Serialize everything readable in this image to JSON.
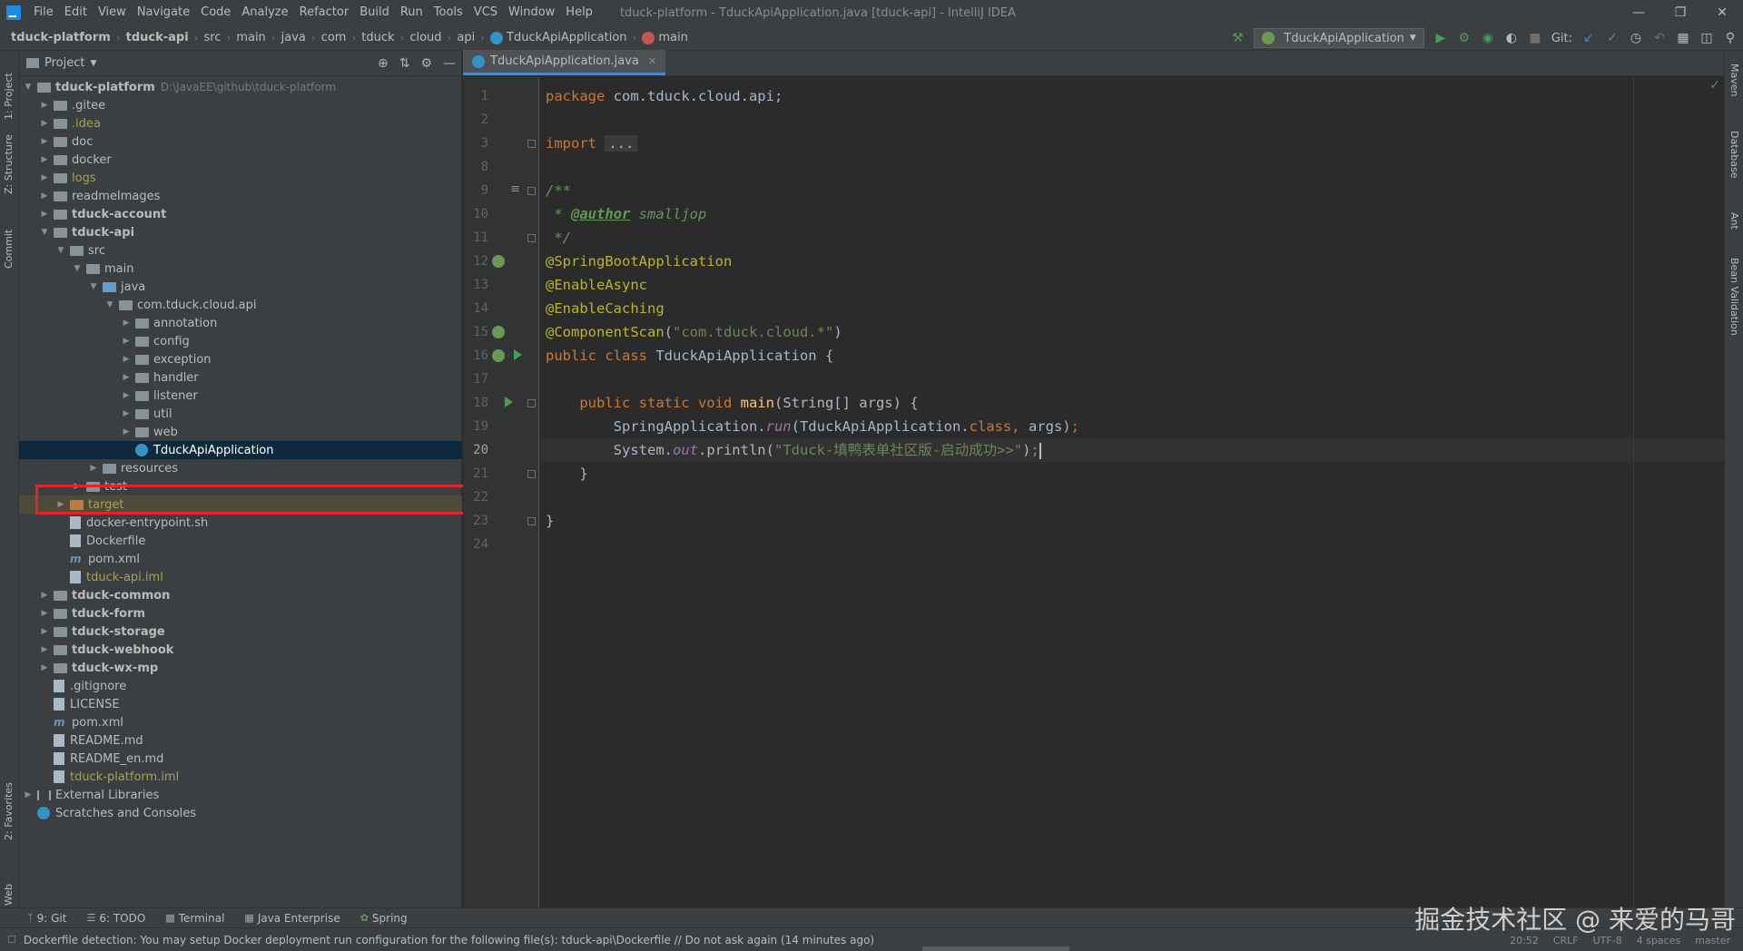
{
  "menubar": {
    "items": [
      "File",
      "Edit",
      "View",
      "Navigate",
      "Code",
      "Analyze",
      "Refactor",
      "Build",
      "Run",
      "Tools",
      "VCS",
      "Window",
      "Help"
    ],
    "title": "tduck-platform - TduckApiApplication.java [tduck-api] - IntelliJ IDEA"
  },
  "breadcrumb": [
    "tduck-platform",
    "tduck-api",
    "src",
    "main",
    "java",
    "com",
    "tduck",
    "cloud",
    "api",
    "TduckApiApplication",
    "main"
  ],
  "toolbar": {
    "run_config": "TduckApiApplication",
    "git_label": "Git:"
  },
  "left_stripe": {
    "project": "1: Project",
    "structure": "Z: Structure",
    "commit": "Commit",
    "favorites": "2: Favorites",
    "web": "Web"
  },
  "right_stripe": {
    "maven": "Maven",
    "database": "Database",
    "ant": "Ant",
    "bean": "Bean Validation"
  },
  "project_panel": {
    "title": "Project"
  },
  "tree": [
    {
      "label": "tduck-platform",
      "path": "D:\\JavaEE\\github\\tduck-platform"
    },
    {
      "label": ".gitee"
    },
    {
      "label": ".idea"
    },
    {
      "label": "doc"
    },
    {
      "label": "docker"
    },
    {
      "label": "logs"
    },
    {
      "label": "readmeImages"
    },
    {
      "label": "tduck-account"
    },
    {
      "label": "tduck-api"
    },
    {
      "label": "src"
    },
    {
      "label": "main"
    },
    {
      "label": "java"
    },
    {
      "label": "com.tduck.cloud.api"
    },
    {
      "label": "annotation"
    },
    {
      "label": "config"
    },
    {
      "label": "exception"
    },
    {
      "label": "handler"
    },
    {
      "label": "listener"
    },
    {
      "label": "util"
    },
    {
      "label": "web"
    },
    {
      "label": "TduckApiApplication"
    },
    {
      "label": "resources"
    },
    {
      "label": "test"
    },
    {
      "label": "target"
    },
    {
      "label": "docker-entrypoint.sh"
    },
    {
      "label": "Dockerfile"
    },
    {
      "label": "pom.xml"
    },
    {
      "label": "tduck-api.iml"
    },
    {
      "label": "tduck-common"
    },
    {
      "label": "tduck-form"
    },
    {
      "label": "tduck-storage"
    },
    {
      "label": "tduck-webhook"
    },
    {
      "label": "tduck-wx-mp"
    },
    {
      "label": ".gitignore"
    },
    {
      "label": "LICENSE"
    },
    {
      "label": "pom.xml"
    },
    {
      "label": "README.md"
    },
    {
      "label": "README_en.md"
    },
    {
      "label": "tduck-platform.iml"
    },
    {
      "label": "External Libraries"
    },
    {
      "label": "Scratches and Consoles"
    }
  ],
  "editor": {
    "tab": "TduckApiApplication.java",
    "line_numbers": [
      "1",
      "2",
      "3",
      "8",
      "9",
      "10",
      "11",
      "12",
      "13",
      "14",
      "15",
      "16",
      "17",
      "18",
      "19",
      "20",
      "21",
      "22",
      "23",
      "24"
    ],
    "current_line": "20",
    "code": {
      "l1_kw": "package",
      "l1_rest": " com.tduck.cloud.api;",
      "l3_kw": "import",
      "l3_fold": "...",
      "l9": "/**",
      "l10_a": " * ",
      "l10_tag": "@author",
      "l10_b": " smalljop",
      "l11": " */",
      "l12": "@SpringBootApplication",
      "l13": "@EnableAsync",
      "l14": "@EnableCaching",
      "l15_ann": "@ComponentScan",
      "l15_p1": "(",
      "l15_str": "\"com.tduck.cloud.*\"",
      "l15_p2": ")",
      "l16_kw": "public class",
      "l16_name": " TduckApiApplication {",
      "l18_kw": "    public static void",
      "l18_fn": " main",
      "l18_rest": "(String[] args) {",
      "l19_a": "        SpringApplication.",
      "l19_run": "run",
      "l19_b": "(TduckApiApplication.",
      "l19_cls": "class",
      "l19_comma": ",",
      "l19_c": " args)",
      "l19_semi": ";",
      "l20_a": "        System.",
      "l20_out": "out",
      "l20_b": ".println(",
      "l20_str": "\"Tduck-填鸭表单社区版-启动成功>>\"",
      "l20_c": ")",
      "l20_semi": ";",
      "l21": "    }",
      "l23": "}"
    }
  },
  "bottom_tools": [
    "9: Git",
    "6: TODO",
    "Terminal",
    "Java Enterprise",
    "Spring"
  ],
  "status": {
    "message": "Dockerfile detection: You may setup Docker deployment run configuration for the following file(s): tduck-api\\Dockerfile // Do not ask again (14 minutes ago)",
    "position": "20:52",
    "line_sep": "CRLF",
    "encoding": "UTF-8",
    "indent": "4 spaces",
    "branch": "master"
  },
  "watermark": "掘金技术社区 @ 来爱的马哥"
}
